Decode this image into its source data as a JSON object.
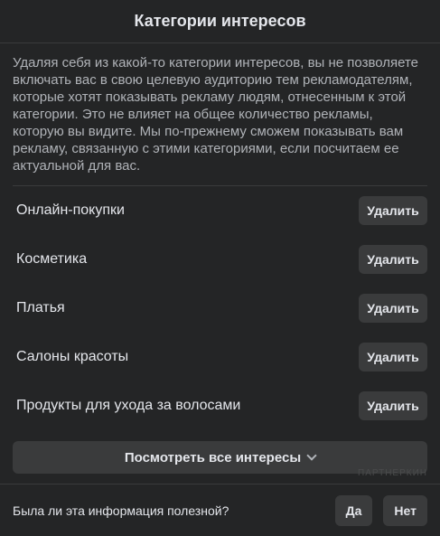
{
  "header": {
    "title": "Категории интересов"
  },
  "description": "Удаляя себя из какой-то категории интересов, вы не позволяете включать вас в свою целевую аудиторию тем рекламодателям, которые хотят показывать рекламу людям, отнесенным к этой категории. Это не влияет на общее количество рекламы, которую вы видите. Мы по-прежнему сможем показывать вам рекламу, связанную с этими категориями, если посчитаем ее актуальной для вас.",
  "categories": [
    {
      "label": "Онлайн-покупки",
      "action": "Удалить"
    },
    {
      "label": "Косметика",
      "action": "Удалить"
    },
    {
      "label": "Платья",
      "action": "Удалить"
    },
    {
      "label": "Салоны красоты",
      "action": "Удалить"
    },
    {
      "label": "Продукты для ухода за волосами",
      "action": "Удалить"
    }
  ],
  "see_all_label": "Посмотреть все интересы",
  "footer": {
    "question": "Была ли эта информация полезной?",
    "yes_label": "Да",
    "no_label": "Нет"
  },
  "watermark": "ПАРТНЕРКИН"
}
